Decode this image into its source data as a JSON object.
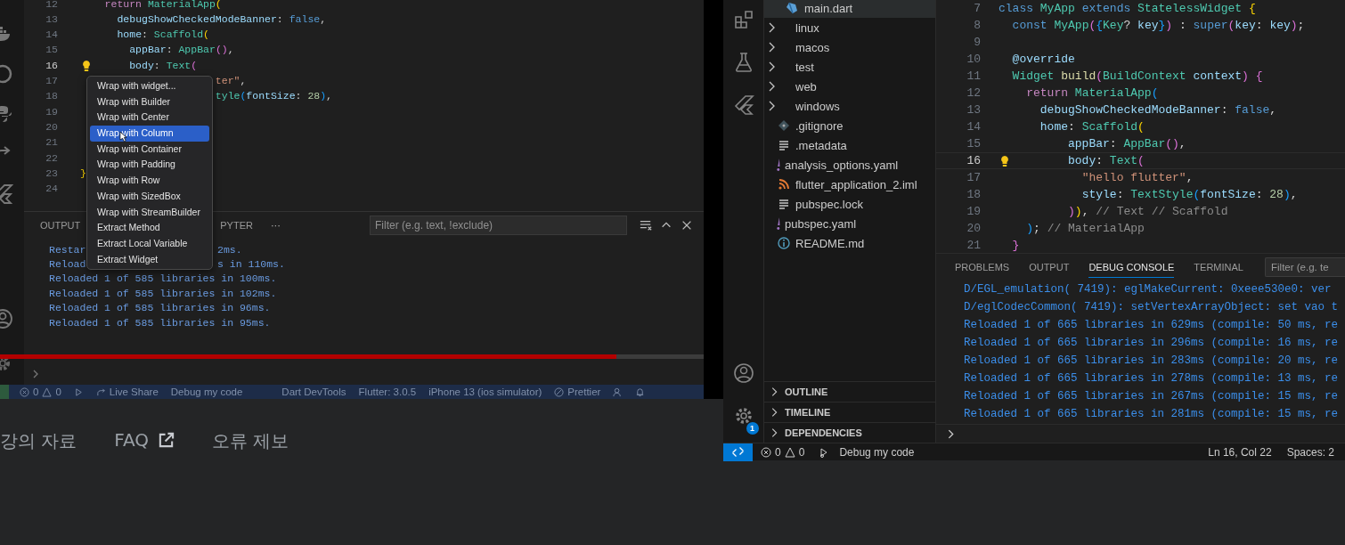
{
  "left_window": {
    "editor": {
      "lines": [
        {
          "number": "12",
          "current": false,
          "tokens": [
            {
              "text": "    return",
              "kind": "ctrl"
            },
            {
              "text": " MaterialApp",
              "kind": "type"
            },
            {
              "text": "(",
              "kind": "b1"
            }
          ]
        },
        {
          "number": "13",
          "current": false,
          "tokens": [
            {
              "text": "      debugShowCheckedModeBanner",
              "kind": "prop"
            },
            {
              "text": ": ",
              "kind": "p"
            },
            {
              "text": "false",
              "kind": "kw"
            },
            {
              "text": ",",
              "kind": "p"
            }
          ]
        },
        {
          "number": "14",
          "current": false,
          "tokens": [
            {
              "text": "      home",
              "kind": "prop"
            },
            {
              "text": ": ",
              "kind": "p"
            },
            {
              "text": "Scaffold",
              "kind": "type"
            },
            {
              "text": "(",
              "kind": "b1"
            }
          ]
        },
        {
          "number": "15",
          "current": false,
          "tokens": [
            {
              "text": "        appBar",
              "kind": "prop"
            },
            {
              "text": ": ",
              "kind": "p"
            },
            {
              "text": "AppBar",
              "kind": "type"
            },
            {
              "text": "()",
              "kind": "b2"
            },
            {
              "text": ",",
              "kind": "p"
            }
          ]
        },
        {
          "number": "16",
          "current": true,
          "tokens": [
            {
              "text": "        body",
              "kind": "prop"
            },
            {
              "text": ": ",
              "kind": "p"
            },
            {
              "text": "Text",
              "kind": "type"
            },
            {
              "text": "(",
              "kind": "b2"
            }
          ]
        },
        {
          "number": "17",
          "current": false,
          "tokens": [
            {
              "text": "                      ter\"",
              "kind": "str"
            },
            {
              "text": ",",
              "kind": "p"
            }
          ]
        },
        {
          "number": "18",
          "current": false,
          "tokens": [
            {
              "text": "                      tyle",
              "kind": "type"
            },
            {
              "text": "(",
              "kind": "b3"
            },
            {
              "text": "fontSize",
              "kind": "prop"
            },
            {
              "text": ": ",
              "kind": "p"
            },
            {
              "text": "28",
              "kind": "num"
            },
            {
              "text": ")",
              "kind": "b3"
            },
            {
              "text": ",",
              "kind": "p"
            }
          ]
        },
        {
          "number": "19",
          "current": false
        },
        {
          "number": "20",
          "current": false
        },
        {
          "number": "21",
          "current": false
        },
        {
          "number": "22",
          "current": false
        },
        {
          "number": "23",
          "current": false,
          "tokens": [
            {
              "text": "}",
              "kind": "b1"
            }
          ]
        },
        {
          "number": "24",
          "current": false
        }
      ]
    },
    "context_menu": {
      "items": [
        {
          "label": "Wrap with widget...",
          "selected": false
        },
        {
          "label": "Wrap with Builder",
          "selected": false
        },
        {
          "label": "Wrap with Center",
          "selected": false
        },
        {
          "label": "Wrap with Column",
          "selected": true
        },
        {
          "label": "Wrap with Container",
          "selected": false
        },
        {
          "label": "Wrap with Padding",
          "selected": false
        },
        {
          "label": "Wrap with Row",
          "selected": false
        },
        {
          "label": "Wrap with SizedBox",
          "selected": false
        },
        {
          "label": "Wrap with StreamBuilder",
          "selected": false
        },
        {
          "label": "Extract Method",
          "selected": false
        },
        {
          "label": "Extract Local Variable",
          "selected": false
        },
        {
          "label": "Extract Widget",
          "selected": false
        }
      ]
    },
    "panel": {
      "tabs": [
        "OUTPUT",
        "PYTER"
      ],
      "more": "···",
      "filter": {
        "placeholder": "Filter (e.g. text, !exclude)"
      },
      "output": [
        {
          "parts": [
            "Restar",
            "2ms."
          ]
        },
        {
          "parts": [
            "Reload",
            "s in 110ms."
          ]
        },
        {
          "parts": [
            "Reloaded 1 of 585 libraries in 100ms."
          ]
        },
        {
          "parts": [
            "Reloaded 1 of 585 libraries in 102ms."
          ]
        },
        {
          "parts": [
            "Reloaded 1 of 585 libraries in 96ms."
          ]
        },
        {
          "parts": [
            "Reloaded 1 of 585 libraries in 95ms."
          ]
        }
      ]
    },
    "status_bar": {
      "errors": "0",
      "warnings": "0",
      "live_share": "Live Share",
      "launch": "Debug my code",
      "devtools": "Dart DevTools",
      "flutter": "Flutter: 3.0.5",
      "device": "iPhone 13 (ios simulator)",
      "prettier": "Prettier"
    }
  },
  "video": {
    "progress": {
      "level": 0.876
    }
  },
  "links": [
    {
      "label": "강의 자료",
      "external": false
    },
    {
      "label": "FAQ",
      "external": true
    },
    {
      "label": "오류 제보",
      "external": false
    }
  ],
  "right_window": {
    "activity_bar": {
      "settings_badge": "1"
    },
    "explorer": {
      "items": [
        {
          "label": "main.dart",
          "kind": "dart",
          "selected": true
        },
        {
          "label": "linux",
          "kind": "folder",
          "selected": false
        },
        {
          "label": "macos",
          "kind": "folder",
          "selected": false
        },
        {
          "label": "test",
          "kind": "folder",
          "selected": false
        },
        {
          "label": "web",
          "kind": "folder",
          "selected": false
        },
        {
          "label": "windows",
          "kind": "folder",
          "selected": false
        },
        {
          "label": ".gitignore",
          "kind": "git",
          "selected": false
        },
        {
          "label": ".metadata",
          "kind": "lines",
          "selected": false
        },
        {
          "label": "analysis_options.yaml",
          "kind": "yaml",
          "selected": false
        },
        {
          "label": "flutter_application_2.iml",
          "kind": "feed",
          "selected": false
        },
        {
          "label": "pubspec.lock",
          "kind": "lines",
          "selected": false
        },
        {
          "label": "pubspec.yaml",
          "kind": "yaml",
          "selected": false
        },
        {
          "label": "README.md",
          "kind": "info",
          "selected": false
        }
      ],
      "sections": [
        "OUTLINE",
        "TIMELINE",
        "DEPENDENCIES"
      ]
    },
    "editor": {
      "lines": [
        {
          "number": "7",
          "current": false,
          "tokens": [
            {
              "text": "class",
              "kind": "kw"
            },
            {
              "text": " MyApp",
              "kind": "type"
            },
            {
              "text": " extends",
              "kind": "kw"
            },
            {
              "text": " StatelessWidget",
              "kind": "type"
            },
            {
              "text": " {",
              "kind": "b1"
            }
          ]
        },
        {
          "number": "8",
          "current": false,
          "tokens": [
            {
              "text": "  const",
              "kind": "kw"
            },
            {
              "text": " MyApp",
              "kind": "type"
            },
            {
              "text": "(",
              "kind": "b2"
            },
            {
              "text": "{",
              "kind": "b3"
            },
            {
              "text": "Key",
              "kind": "type"
            },
            {
              "text": "?",
              "kind": "p"
            },
            {
              "text": " key",
              "kind": "prop"
            },
            {
              "text": "}",
              "kind": "b3"
            },
            {
              "text": ")",
              "kind": "b2"
            },
            {
              "text": " : ",
              "kind": "p"
            },
            {
              "text": "super",
              "kind": "kw"
            },
            {
              "text": "(",
              "kind": "b2"
            },
            {
              "text": "key",
              "kind": "prop"
            },
            {
              "text": ": ",
              "kind": "p"
            },
            {
              "text": "key",
              "kind": "prop"
            },
            {
              "text": ")",
              "kind": "b2"
            },
            {
              "text": ";",
              "kind": "p"
            }
          ]
        },
        {
          "number": "9",
          "current": false
        },
        {
          "number": "10",
          "current": false,
          "tokens": [
            {
              "text": "  @override",
              "kind": "prop"
            }
          ]
        },
        {
          "number": "11",
          "current": false,
          "tokens": [
            {
              "text": "  Widget",
              "kind": "type"
            },
            {
              "text": " build",
              "kind": "fn"
            },
            {
              "text": "(",
              "kind": "b2"
            },
            {
              "text": "BuildContext",
              "kind": "type"
            },
            {
              "text": " context",
              "kind": "prop"
            },
            {
              "text": ")",
              "kind": "b2"
            },
            {
              "text": " {",
              "kind": "b2"
            }
          ]
        },
        {
          "number": "12",
          "current": false,
          "tokens": [
            {
              "text": "    return",
              "kind": "ctrl"
            },
            {
              "text": " MaterialApp",
              "kind": "type"
            },
            {
              "text": "(",
              "kind": "b3"
            }
          ]
        },
        {
          "number": "13",
          "current": false,
          "tokens": [
            {
              "text": "      debugShowCheckedModeBanner",
              "kind": "prop"
            },
            {
              "text": ": ",
              "kind": "p"
            },
            {
              "text": "false",
              "kind": "kw"
            },
            {
              "text": ",",
              "kind": "p"
            }
          ]
        },
        {
          "number": "14",
          "current": false,
          "tokens": [
            {
              "text": "      home",
              "kind": "prop"
            },
            {
              "text": ": ",
              "kind": "p"
            },
            {
              "text": "Scaffold",
              "kind": "type"
            },
            {
              "text": "(",
              "kind": "b1"
            }
          ]
        },
        {
          "number": "15",
          "current": false,
          "tokens": [
            {
              "text": "          appBar",
              "kind": "prop"
            },
            {
              "text": ": ",
              "kind": "p"
            },
            {
              "text": "AppBar",
              "kind": "type"
            },
            {
              "text": "()",
              "kind": "b2"
            },
            {
              "text": ",",
              "kind": "p"
            }
          ]
        },
        {
          "number": "16",
          "current": true,
          "tokens": [
            {
              "text": "          body",
              "kind": "prop"
            },
            {
              "text": ": ",
              "kind": "p"
            },
            {
              "text": "Text",
              "kind": "type"
            },
            {
              "text": "(",
              "kind": "b2"
            }
          ]
        },
        {
          "number": "17",
          "current": false,
          "tokens": [
            {
              "text": "            \"hello flutter\"",
              "kind": "str"
            },
            {
              "text": ",",
              "kind": "p"
            }
          ]
        },
        {
          "number": "18",
          "current": false,
          "tokens": [
            {
              "text": "            style",
              "kind": "prop"
            },
            {
              "text": ": ",
              "kind": "p"
            },
            {
              "text": "TextStyle",
              "kind": "type"
            },
            {
              "text": "(",
              "kind": "b3"
            },
            {
              "text": "fontSize",
              "kind": "prop"
            },
            {
              "text": ": ",
              "kind": "p"
            },
            {
              "text": "28",
              "kind": "num"
            },
            {
              "text": ")",
              "kind": "b3"
            },
            {
              "text": ",",
              "kind": "p"
            }
          ]
        },
        {
          "number": "19",
          "current": false,
          "tokens": [
            {
              "text": "          )",
              "kind": "b2"
            },
            {
              "text": ")",
              "kind": "b1"
            },
            {
              "text": ", ",
              "kind": "p"
            },
            {
              "text": "// Text // Scaffold",
              "kind": "cm"
            }
          ]
        },
        {
          "number": "20",
          "current": false,
          "tokens": [
            {
              "text": "    )",
              "kind": "b3"
            },
            {
              "text": "; ",
              "kind": "p"
            },
            {
              "text": "// MaterialApp",
              "kind": "cm"
            }
          ]
        },
        {
          "number": "21",
          "current": false,
          "tokens": [
            {
              "text": "  }",
              "kind": "b2"
            }
          ]
        }
      ]
    },
    "panel": {
      "tabs": [
        {
          "label": "PROBLEMS",
          "selected": false
        },
        {
          "label": "OUTPUT",
          "selected": false
        },
        {
          "label": "DEBUG CONSOLE",
          "selected": true
        },
        {
          "label": "TERMINAL",
          "selected": false
        }
      ],
      "filter": {
        "placeholder": "Filter (e.g. te"
      },
      "output": [
        "D/EGL_emulation( 7419): eglMakeCurrent: 0xeee530e0: ver",
        "D/eglCodecCommon( 7419): setVertexArrayObject: set vao t",
        "Reloaded 1 of 665 libraries in 629ms (compile: 50 ms, re",
        "Reloaded 1 of 665 libraries in 296ms (compile: 16 ms, re",
        "Reloaded 1 of 665 libraries in 283ms (compile: 20 ms, re",
        "Reloaded 1 of 665 libraries in 278ms (compile: 13 ms, re",
        "Reloaded 1 of 665 libraries in 267ms (compile: 15 ms, re",
        "Reloaded 1 of 665 libraries in 281ms (compile: 15 ms, re"
      ]
    },
    "status_bar": {
      "errors": "0",
      "warnings": "0",
      "launch": "Debug my code",
      "position": "Ln 16, Col 22",
      "spaces": "Spaces: 2"
    }
  }
}
